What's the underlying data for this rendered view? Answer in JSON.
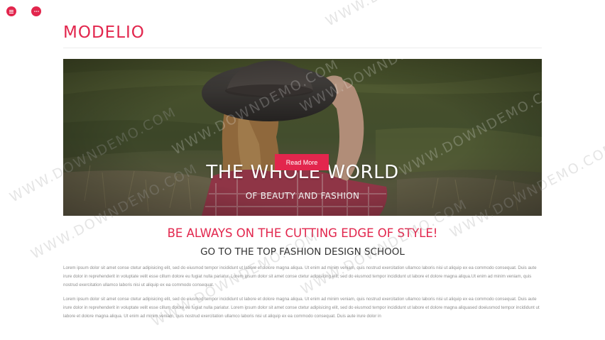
{
  "brand": {
    "logo": "MODELIO",
    "accent_color": "#e2264d"
  },
  "top_controls": {
    "menu_icon": "hamburger-menu-icon",
    "more_icon": "ellipsis-icon"
  },
  "hero": {
    "title": "THE WHOLE WORLD",
    "subtitle": "OF BEAUTY AND FASHION",
    "button_label": "Read More",
    "image": "woman in hat and plaid shirt sitting in a grass field"
  },
  "content": {
    "tagline": "BE ALWAYS ON THE CUTTING EDGE OF STYLE!",
    "subtitle": "GO TO THE TOP FASHION DESIGN SCHOOL",
    "paragraph1": "Lorem ipsum dolor sit amet conse ctetur adipisicing elit, sed do eiusmod tempor incididunt ut labore et dolore magna aliqua. Ut enim ad minim veniam, quis nostrud exercitation ullamco laboris nisi ut aliquip ex ea commodo consequat. Duis aute irure dolor in reprehenderit in voluptate velit esse cillum dolore eu fugiat nulla pariatur. Lorem ipsum dolor sit amet conse ctetur adipisicing elit, sed do eiusmod tempor incididunt ut labore et dolore magna aliqua.Ut enim ad minim veniam, quis nostrud exercitation ullamco laboris nisi ut aliquip ex ea commodo consequat.",
    "paragraph2": "Lorem ipsum dolor sit amet conse ctetur adipisicing elit, sed do eiusmod tempor incididunt ut labore et dolore magna aliqua. Ut enim ad minim veniam, quis nostrud exercitation ullamco laboris nisi ut aliquip ex ea commodo consequat. Duis aute irure dolor in reprehenderit in voluptate velit esse cillum dolore eu fugiat nulla pariatur. Lorem ipsum dolor sit amet conse ctetur adipisicing elit, sed do eiusmod tempor incididunt ut labore et dolore magna aliquased doeiusmod tempor incididunt ut labore et dolore magna aliqua. Ut enim ad minim veniam, quis nostrud exercitation ullamco laboris nisi ut aliquip ex ea commodo consequat. Duis aute irure dolor in"
  },
  "watermark": "WWW.DOWNDEMO.COM"
}
